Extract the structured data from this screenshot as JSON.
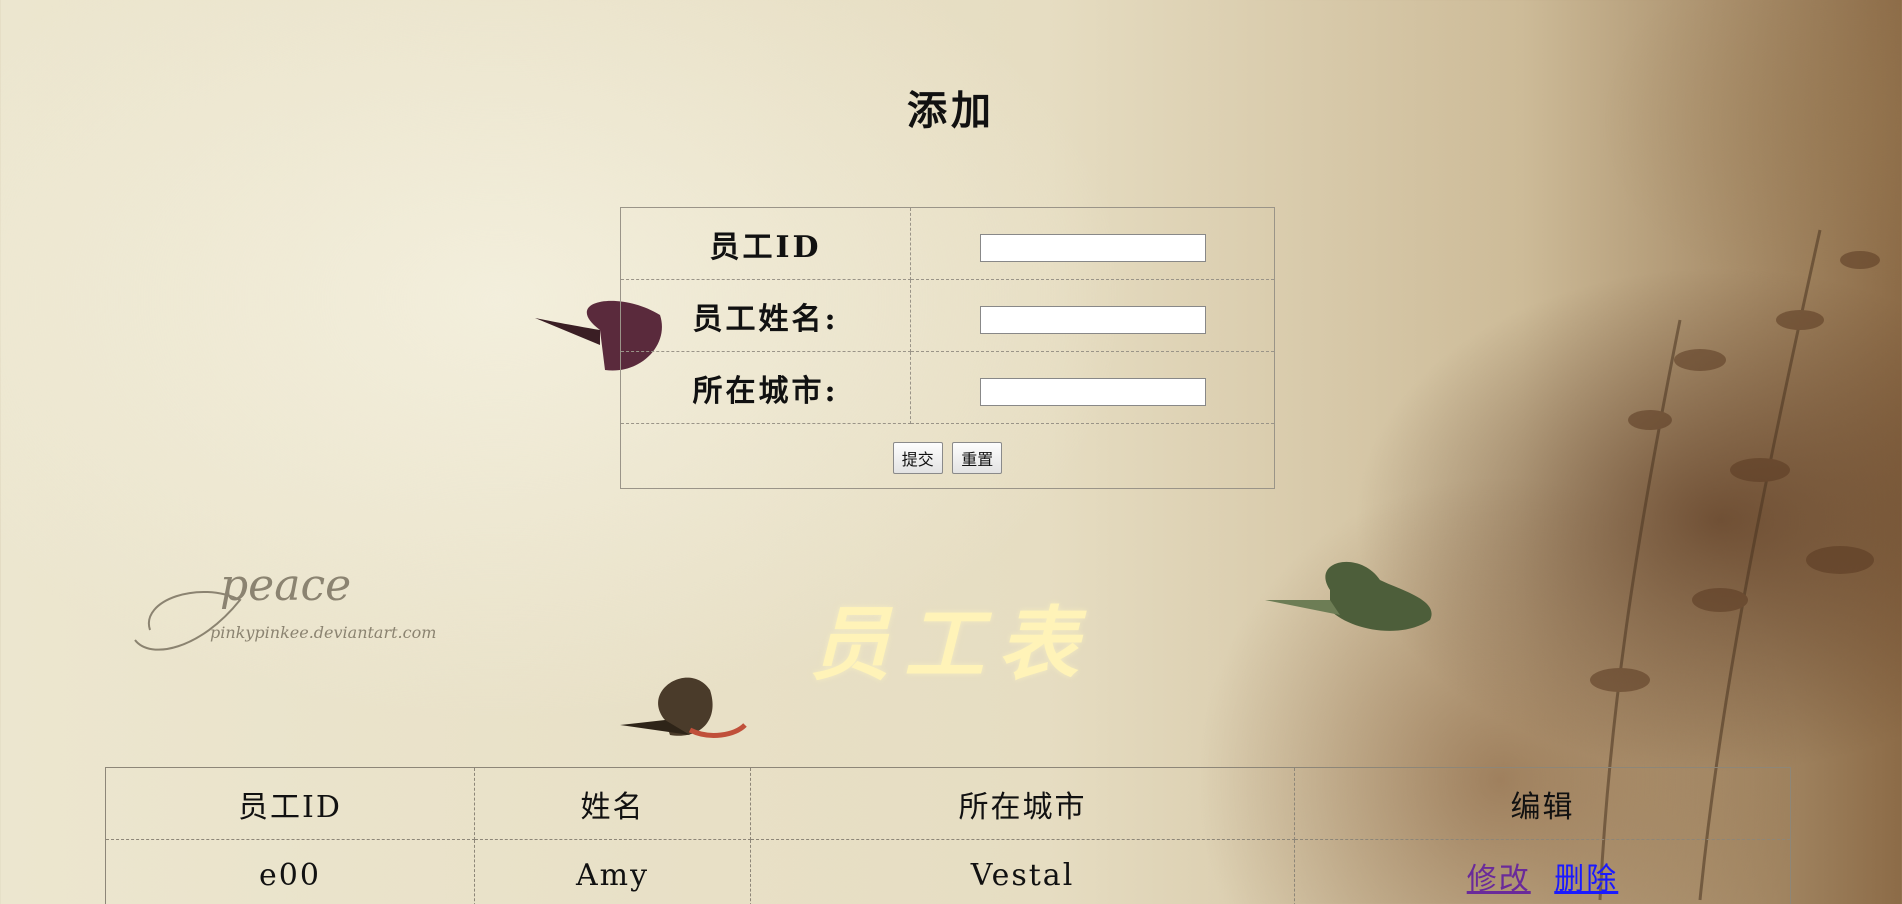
{
  "page_title": "添加",
  "form": {
    "fields": [
      {
        "label": "员工ID",
        "value": "",
        "placeholder": ""
      },
      {
        "label": "员工姓名:",
        "value": "",
        "placeholder": ""
      },
      {
        "label": "所在城市:",
        "value": "",
        "placeholder": ""
      }
    ],
    "submit_label": "提交",
    "reset_label": "重置"
  },
  "table_title": "员工表",
  "table": {
    "headers": [
      "员工ID",
      "姓名",
      "所在城市",
      "编辑"
    ],
    "rows": [
      {
        "id": "e00",
        "name": "Amy",
        "city": "Vestal",
        "edit_label": "修改",
        "delete_label": "删除"
      }
    ]
  },
  "watermark": {
    "text": "peace",
    "subtext": "pinkypinkee.deviantart.com"
  },
  "colors": {
    "section_title": "#fff3b8",
    "link": "#1a1aff",
    "visited_link": "#6a2a9a",
    "border": "#9a9488"
  }
}
